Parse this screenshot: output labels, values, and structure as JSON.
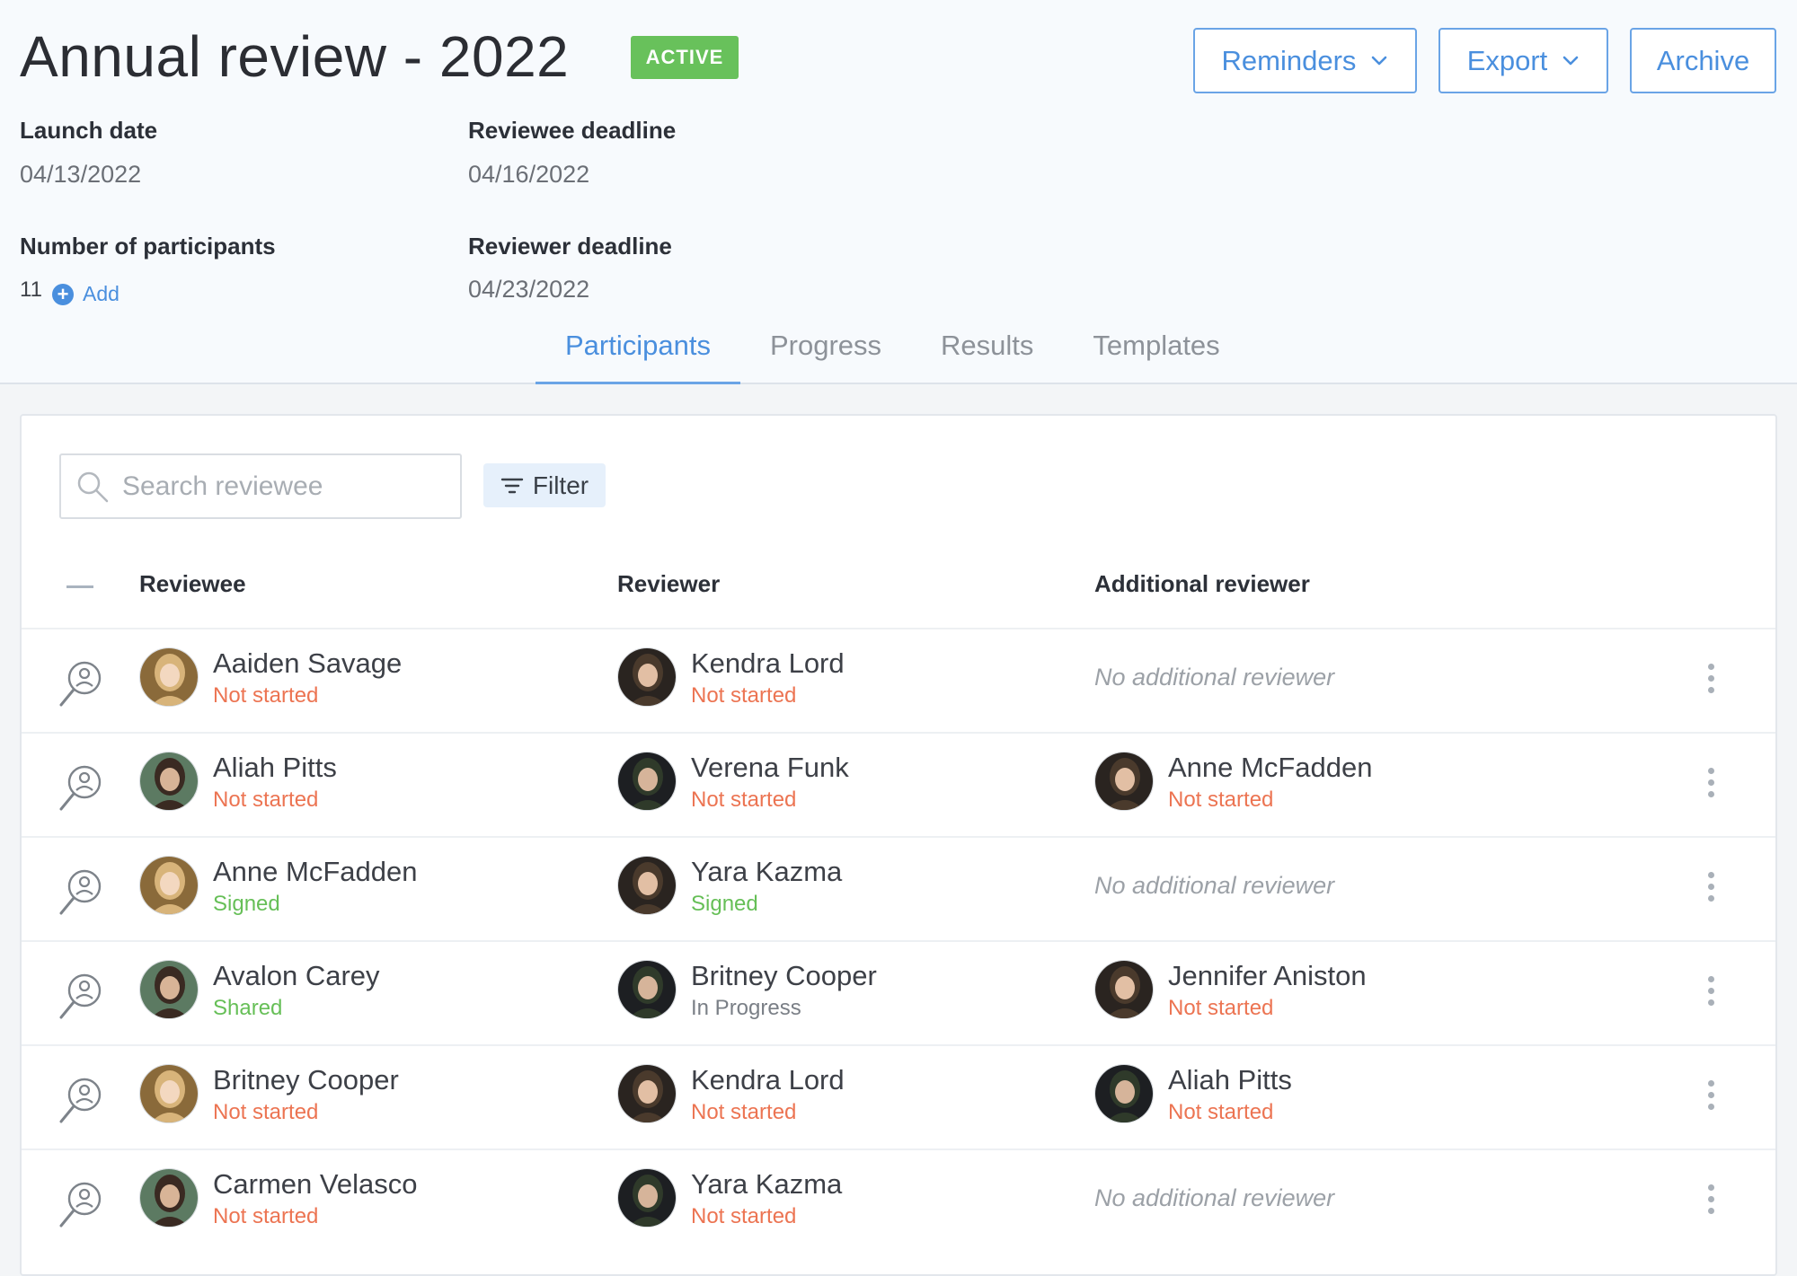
{
  "header": {
    "title": "Annual review - 2022",
    "status_badge": "ACTIVE",
    "buttons": {
      "reminders": "Reminders",
      "export": "Export",
      "archive": "Archive"
    },
    "meta": {
      "launch_date_label": "Launch date",
      "launch_date": "04/13/2022",
      "reviewee_deadline_label": "Reviewee deadline",
      "reviewee_deadline": "04/16/2022",
      "participants_label": "Number of participants",
      "participants_count": "11",
      "add_label": "Add",
      "reviewer_deadline_label": "Reviewer deadline",
      "reviewer_deadline": "04/23/2022"
    },
    "tabs": [
      "Participants",
      "Progress",
      "Results",
      "Templates"
    ],
    "active_tab": "Participants"
  },
  "toolbar": {
    "search_placeholder": "Search reviewee",
    "filter_label": "Filter"
  },
  "table": {
    "columns": {
      "reviewee": "Reviewee",
      "reviewer": "Reviewer",
      "additional": "Additional reviewer"
    },
    "no_additional": "No additional reviewer",
    "rows": [
      {
        "reviewee": {
          "name": "Aaiden Savage",
          "status": "Not started"
        },
        "reviewer": {
          "name": "Kendra Lord",
          "status": "Not started"
        },
        "additional": null
      },
      {
        "reviewee": {
          "name": "Aliah Pitts",
          "status": "Not started"
        },
        "reviewer": {
          "name": "Verena Funk",
          "status": "Not started"
        },
        "additional": {
          "name": "Anne McFadden",
          "status": "Not started"
        }
      },
      {
        "reviewee": {
          "name": "Anne McFadden",
          "status": "Signed"
        },
        "reviewer": {
          "name": "Yara Kazma",
          "status": "Signed"
        },
        "additional": null
      },
      {
        "reviewee": {
          "name": "Avalon Carey",
          "status": "Shared"
        },
        "reviewer": {
          "name": "Britney Cooper",
          "status": "In Progress"
        },
        "additional": {
          "name": "Jennifer Aniston",
          "status": "Not started"
        }
      },
      {
        "reviewee": {
          "name": "Britney Cooper",
          "status": "Not started"
        },
        "reviewer": {
          "name": "Kendra Lord",
          "status": "Not started"
        },
        "additional": {
          "name": "Aliah Pitts",
          "status": "Not started"
        }
      },
      {
        "reviewee": {
          "name": "Carmen Velasco",
          "status": "Not started"
        },
        "reviewer": {
          "name": "Yara Kazma",
          "status": "Not started"
        },
        "additional": null
      }
    ]
  },
  "colors": {
    "accent": "#4a8fde",
    "active_badge": "#68c15b",
    "not_started": "#ec7452",
    "signed": "#66bf57",
    "in_progress": "#7a7f86"
  }
}
